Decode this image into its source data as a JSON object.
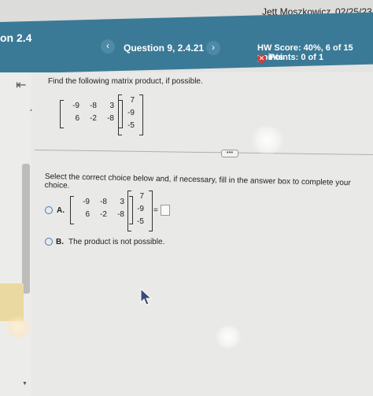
{
  "top_bar": {
    "user_name": "Jett Moszkowicz",
    "date": "02/25/23"
  },
  "header": {
    "section_title": "on 2.4",
    "prev_arrow": "‹",
    "question_title": "Question 9, 2.4.21",
    "next_arrow": "›",
    "hw_score": "HW Score: 40%, 6 of 15 points",
    "points": "Points: 0 of 1",
    "points_status_color": "#c94040",
    "header_color": "#3b7a96"
  },
  "sidebar": {
    "back_icon": "⇤",
    "scroll_up": "▲",
    "scroll_down": "▼"
  },
  "problem": {
    "instruction": "Find the following matrix product, if possible.",
    "matrix_a": [
      [
        "-9",
        "-8",
        "3"
      ],
      [
        "6",
        "-2",
        "-8"
      ]
    ],
    "vector_b": [
      "7",
      "-9",
      "-5"
    ]
  },
  "more_button": "•••",
  "choices": {
    "instruction": "Select the correct choice below and, if necessary, fill in the answer box to complete your choice.",
    "option_a": {
      "label": "A.",
      "matrix_a": [
        [
          "-9",
          "-8",
          "3"
        ],
        [
          "6",
          "-2",
          "-8"
        ]
      ],
      "vector_b": [
        "7",
        "-9",
        "-5"
      ],
      "equals": "="
    },
    "option_b": {
      "label": "B.",
      "text": "The product is not possible."
    }
  }
}
